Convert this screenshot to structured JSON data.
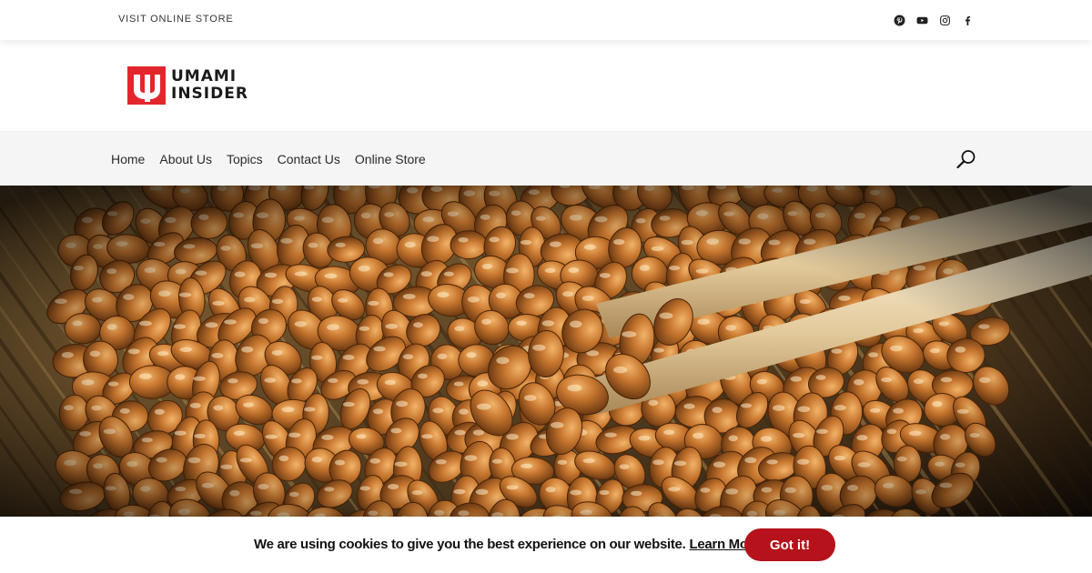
{
  "topbar": {
    "store_link": "VISIT ONLINE STORE",
    "social": [
      {
        "name": "pinterest-icon"
      },
      {
        "name": "youtube-icon"
      },
      {
        "name": "instagram-icon"
      },
      {
        "name": "facebook-icon"
      }
    ]
  },
  "logo": {
    "line1": "UMAMI",
    "line2": "INSIDER",
    "mark_color": "#e3262b"
  },
  "nav": {
    "items": [
      "Home",
      "About Us",
      "Topics",
      "Contact Us",
      "Online Store"
    ],
    "search_icon": "search-icon"
  },
  "hero": {
    "image": "natto-beans-with-chopsticks"
  },
  "cookie": {
    "message": "We are using cookies to give you the best experience on our website.",
    "link": "Learn More.",
    "button": "Got it!",
    "button_color": "#b5121b"
  }
}
